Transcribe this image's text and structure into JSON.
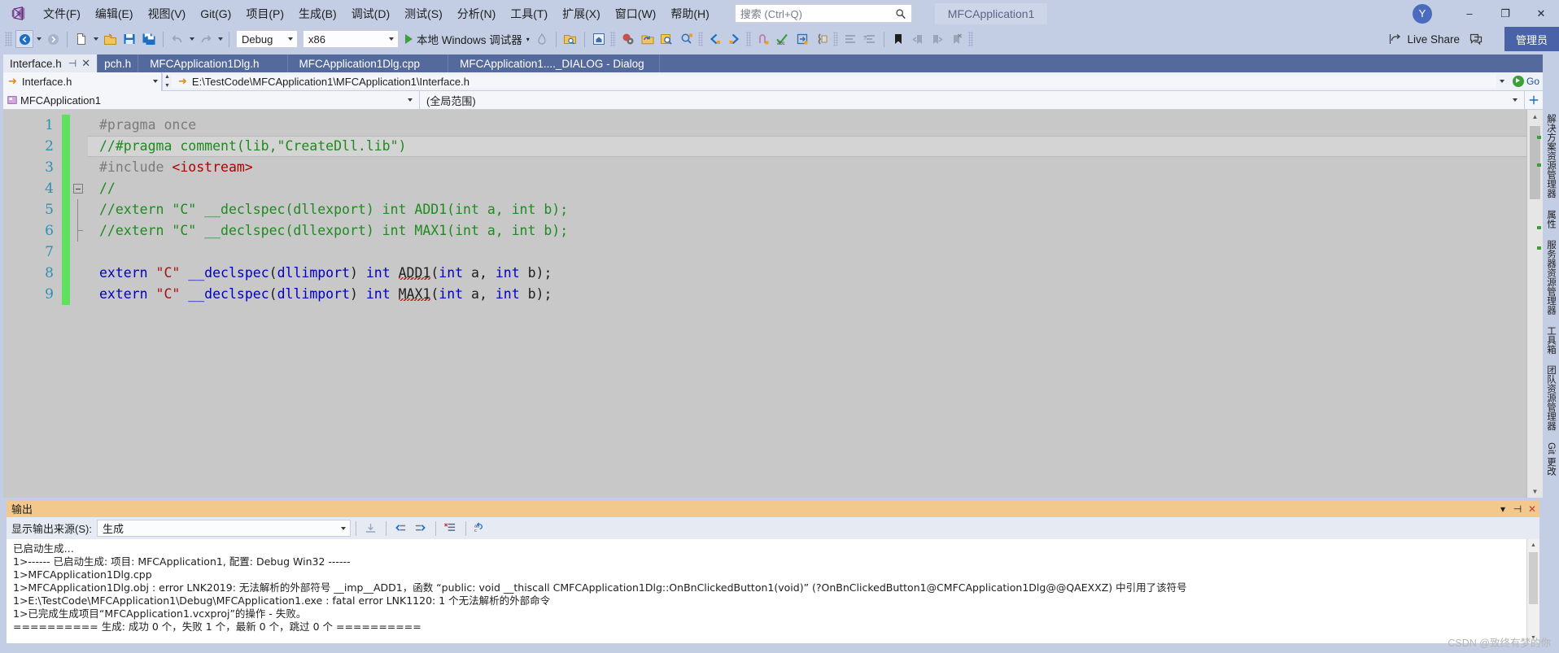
{
  "titlebar": {
    "logo_icon": "vs-logo-icon",
    "menus": [
      {
        "label": "文件(F)"
      },
      {
        "label": "编辑(E)"
      },
      {
        "label": "视图(V)"
      },
      {
        "label": "Git(G)"
      },
      {
        "label": "项目(P)"
      },
      {
        "label": "生成(B)"
      },
      {
        "label": "调试(D)"
      },
      {
        "label": "测试(S)"
      },
      {
        "label": "分析(N)"
      },
      {
        "label": "工具(T)"
      },
      {
        "label": "扩展(X)"
      },
      {
        "label": "窗口(W)"
      },
      {
        "label": "帮助(H)"
      }
    ],
    "search_placeholder": "搜索 (Ctrl+Q)",
    "solution_title": "MFCApplication1",
    "avatar_initial": "Y",
    "window_minimize": "–",
    "window_maximize": "❐",
    "window_close": "✕"
  },
  "toolbar": {
    "configuration": "Debug",
    "platform": "x86",
    "run_label": "本地 Windows 调试器",
    "live_share": "Live Share",
    "admin_label": "管理员"
  },
  "tabs": [
    {
      "label": "Interface.h",
      "active": true,
      "pin": "⊣",
      "close": "✕"
    },
    {
      "label": "pch.h",
      "active": false
    },
    {
      "label": "MFCApplication1Dlg.h",
      "active": false
    },
    {
      "label": "MFCApplication1Dlg.cpp",
      "active": false
    },
    {
      "label": "MFCApplication1...._DIALOG - Dialog",
      "active": false
    }
  ],
  "navbar": {
    "file_name": "Interface.h",
    "file_path": "E:\\TestCode\\MFCApplication1\\MFCApplication1\\Interface.h",
    "go_label": "Go"
  },
  "scopebar": {
    "class_name": "MFCApplication1",
    "function_scope": "(全局范围)"
  },
  "editor": {
    "line_numbers": [
      "1",
      "2",
      "3",
      "4",
      "5",
      "6",
      "7",
      "8",
      "9"
    ],
    "lines": [
      {
        "n": "1",
        "text": "#pragma once"
      },
      {
        "n": "2",
        "text": "//#pragma comment(lib,\"CreateDll.lib\")"
      },
      {
        "n": "3",
        "text": "#include <iostream>"
      },
      {
        "n": "4",
        "text": "//"
      },
      {
        "n": "5",
        "text": "//extern \"C\" __declspec(dllexport) int ADD1(int a, int b);"
      },
      {
        "n": "6",
        "text": "//extern \"C\" __declspec(dllexport) int MAX1(int a, int b);"
      },
      {
        "n": "7",
        "text": ""
      },
      {
        "n": "8",
        "text": "extern \"C\" __declspec(dllimport) int ADD1(int a, int b);"
      },
      {
        "n": "9",
        "text": "extern \"C\" __declspec(dllimport) int MAX1(int a, int b);"
      }
    ],
    "tok": {
      "pragma_once": "#pragma once",
      "comment_pragma": "//#pragma comment(lib,\"CreateDll.lib\")",
      "include": "#include ",
      "include_hdr": "<iostream>",
      "slashes": "//",
      "cmt5": "//extern \"C\" __declspec(dllexport) int ADD1(int a, int b);",
      "cmt6": "//extern \"C\" __declspec(dllexport) int MAX1(int a, int b);",
      "extern": "extern",
      "c_str": "\"C\"",
      "declspec": "__declspec",
      "lparen": "(",
      "dllimport": "dllimport",
      "rparen_sp": ") ",
      "int": "int",
      "add1": "ADD1",
      "max1": "MAX1",
      "args_a": "(",
      "comma_sp": ", ",
      "a": " a",
      "b": " b",
      "end": ");"
    }
  },
  "output": {
    "panel_title": "输出",
    "source_label": "显示输出来源(S):",
    "source_value": "生成",
    "lines": [
      "已启动生成…",
      "1>------ 已启动生成: 项目: MFCApplication1, 配置: Debug Win32 ------",
      "1>MFCApplication1Dlg.cpp",
      "1>MFCApplication1Dlg.obj : error LNK2019: 无法解析的外部符号 __imp__ADD1，函数 “public: void __thiscall CMFCApplication1Dlg::OnBnClickedButton1(void)” (?OnBnClickedButton1@CMFCApplication1Dlg@@QAEXXZ) 中引用了该符号",
      "1>E:\\TestCode\\MFCApplication1\\Debug\\MFCApplication1.exe : fatal error LNK1120: 1 个无法解析的外部命令",
      "1>已完成生成项目“MFCApplication1.vcxproj”的操作 - 失败。",
      "========== 生成: 成功 0 个，失败 1 个，最新 0 个，跳过 0 个 =========="
    ]
  },
  "rightrail": {
    "tabs": [
      "解决方案资源管理器",
      "属性",
      "服务器资源管理器",
      "工具箱",
      "团队资源管理器",
      "Git 更改"
    ]
  },
  "watermark": "CSDN @致终有梦的你"
}
